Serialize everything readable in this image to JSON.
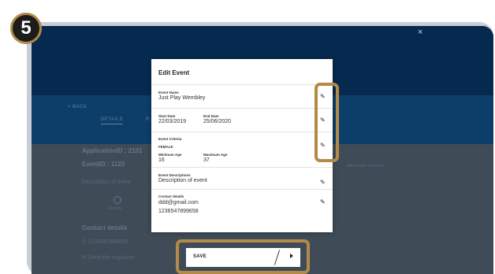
{
  "step": {
    "number": "5"
  },
  "background": {
    "close": "×",
    "back": "< BACK",
    "tab_details": "DETAILS",
    "tab_other": "R",
    "application_id": "ApplicationID : 2101",
    "event_id": "EventID : 1123",
    "description": "Description of event",
    "gender": "Female",
    "contact_heading": "Contact details",
    "phone": "1236547899658",
    "email": "Send the organiser",
    "right_note": "Add a staff on arrival"
  },
  "modal": {
    "title": "Edit Event",
    "event_name_label": "Event Name",
    "event_name": "Just Play Wembley",
    "start_date_label": "Start Date",
    "start_date": "22/03/2019",
    "end_date_label": "End Date",
    "end_date": "25/06/2020",
    "criteria_label": "Event Criteria",
    "gender": "FEMALE",
    "min_age_label": "Minimum Age",
    "min_age": "16",
    "max_age_label": "Maximum Age",
    "max_age": "37",
    "descriptions_label": "Event Descriptions",
    "description": "Description of event",
    "contact_label": "Contact details",
    "email": "ddd@gmail.com",
    "phone": "1236547899658"
  },
  "save": {
    "label": "SAVE"
  },
  "colors": {
    "highlight": "#b38a48",
    "header": "#062a4f",
    "band": "#0c3e6a",
    "badge": "#1c1c1c"
  },
  "icons": {
    "edit": "pencil-icon",
    "next": "chevron-right-icon"
  }
}
